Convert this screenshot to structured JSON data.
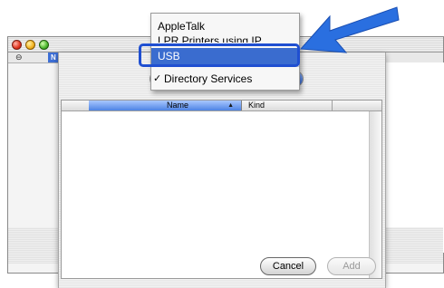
{
  "background_window": {
    "header_icon": "⊖",
    "header_selected_label": "N"
  },
  "dialog": {
    "list": {
      "columns": [
        "Name",
        "Kind"
      ],
      "sort_indicator": "▲"
    },
    "buttons": {
      "cancel": "Cancel",
      "add": "Add"
    }
  },
  "menu": {
    "items": [
      {
        "label": "AppleTalk"
      },
      {
        "label": "LPR Printers using IP"
      },
      {
        "label": "USB",
        "selected": true
      },
      {
        "label": "Directory Services",
        "checked": true,
        "check": "✓"
      }
    ]
  },
  "colors": {
    "selection": "#3a6ccf",
    "highlight_ring": "#1f4fd1",
    "arrow": "#2a6fe0"
  }
}
